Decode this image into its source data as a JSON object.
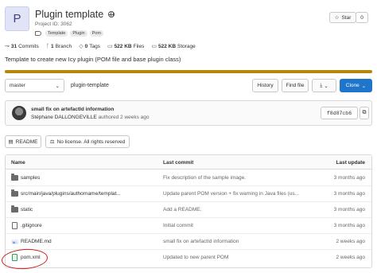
{
  "project": {
    "avatar_letter": "P",
    "title": "Plugin template",
    "id_label": "Project ID: 3062",
    "topics": [
      "Template",
      "Plugin",
      "Pom"
    ]
  },
  "star": {
    "label": "Star",
    "count": "0"
  },
  "stats": {
    "commits": "31",
    "commits_label": "Commits",
    "branches": "1",
    "branches_label": "Branch",
    "tags": "0",
    "tags_label": "Tags",
    "files_size": "522 KB",
    "files_label": "Files",
    "storage_size": "522 KB",
    "storage_label": "Storage"
  },
  "description": "Template to create new Icy plugin (POM file and base plugin class)",
  "language_bar": {
    "fill_percent": 100,
    "color": "#b8860b"
  },
  "toolbar": {
    "branch": "master",
    "path": "plugin-template",
    "history": "History",
    "find_file": "Find file",
    "clone": "Clone"
  },
  "last_commit": {
    "title": "small fix on artefactId information",
    "author": "Stéphane DALLONGEVILLE",
    "meta": "authored 2 weeks ago",
    "sha": "f8d87cb6"
  },
  "info_buttons": {
    "readme": "README",
    "license": "No license. All rights reserved"
  },
  "table": {
    "headers": {
      "name": "Name",
      "last_commit": "Last commit",
      "last_update": "Last update"
    },
    "rows": [
      {
        "type": "folder",
        "name": "samples",
        "commit": "Fix description of the sample image.",
        "updated": "3 months ago"
      },
      {
        "type": "folder",
        "name": "src/main/java/plugins/authorname/templat...",
        "commit": "Update parent POM version + fix warning in Java files (us...",
        "updated": "3 months ago"
      },
      {
        "type": "folder",
        "name": "static",
        "commit": "Add a README.",
        "updated": "3 months ago"
      },
      {
        "type": "file",
        "name": ".gitignore",
        "commit": "Initial commit",
        "updated": "3 months ago"
      },
      {
        "type": "markdown",
        "name": "README.md",
        "commit": "small fix on artefactId information",
        "updated": "2 weeks ago"
      },
      {
        "type": "xml",
        "name": "pom.xml",
        "commit": "Updated to new parent POM",
        "updated": "2 weeks ago"
      }
    ]
  },
  "colors": {
    "primary": "#1f75cb",
    "annotation": "#d11a1a"
  }
}
